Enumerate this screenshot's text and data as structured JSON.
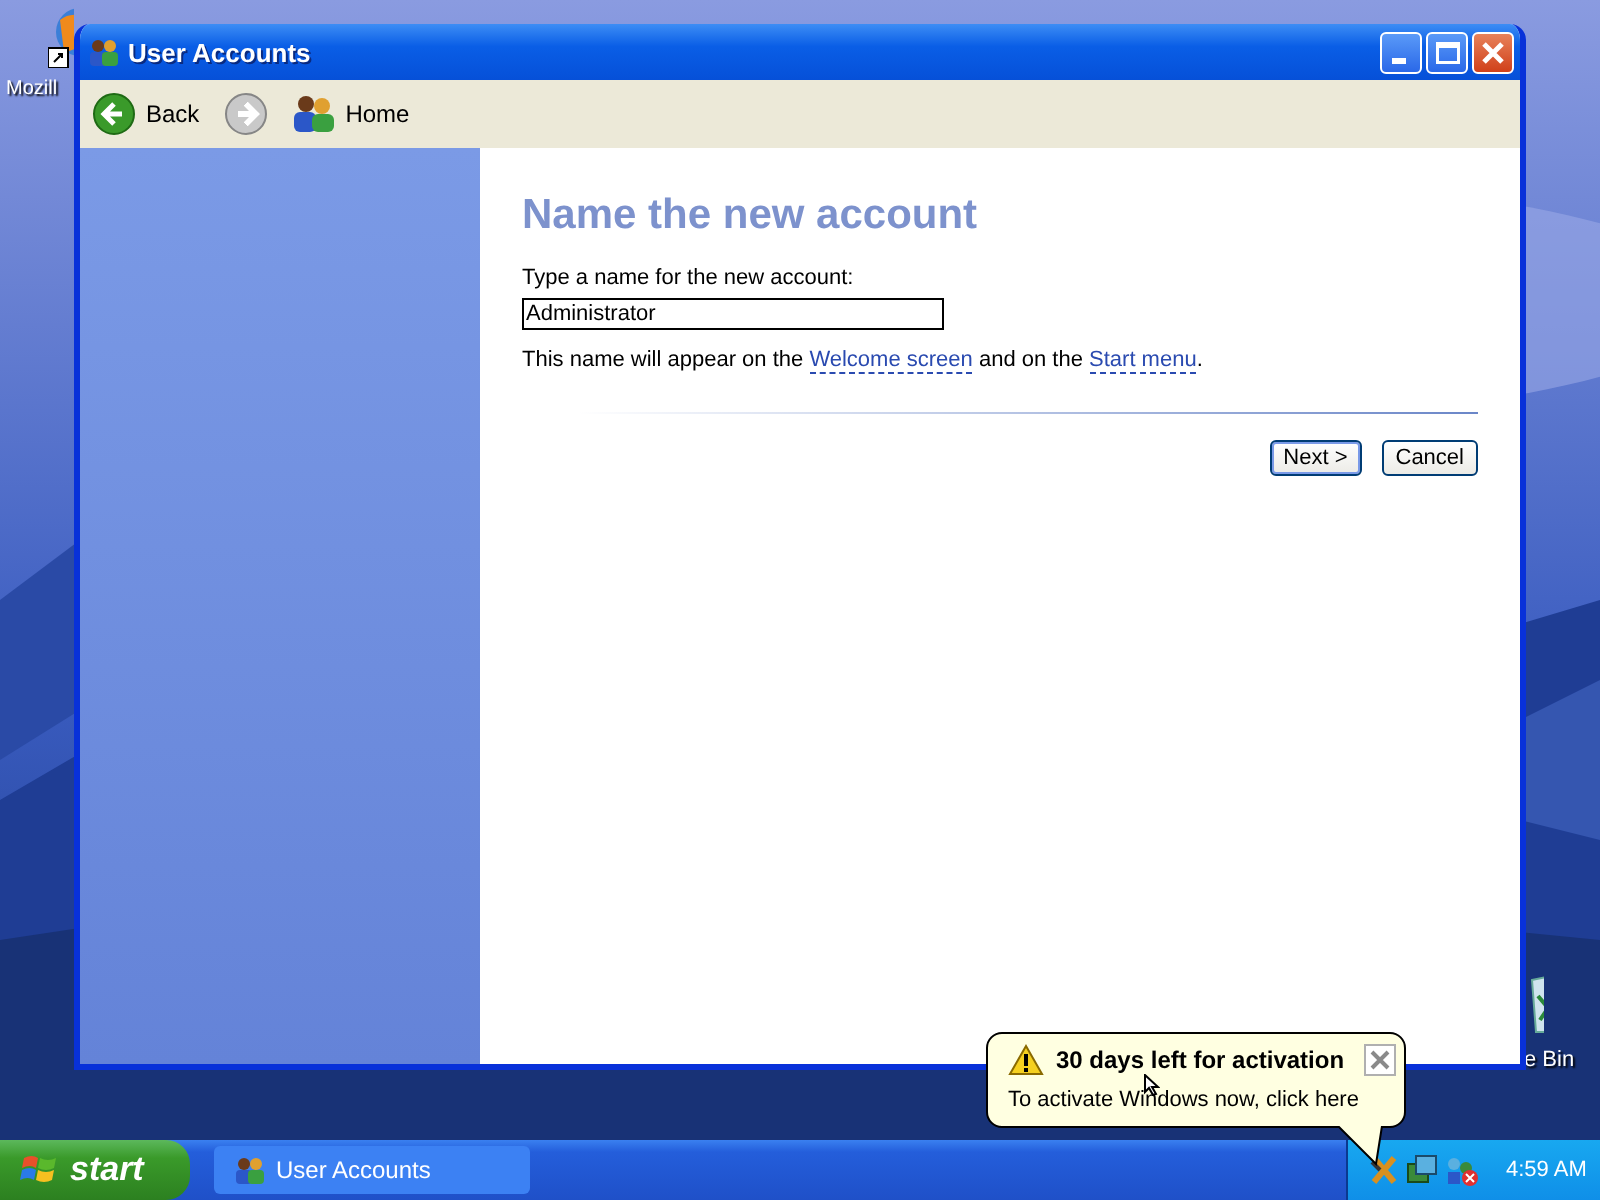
{
  "desktop": {
    "icons": [
      {
        "label": "Mozill",
        "kind": "browser"
      },
      {
        "label": "e Bin",
        "kind": "bin"
      }
    ]
  },
  "window": {
    "title": "User Accounts",
    "toolbar": [
      {
        "kind": "back",
        "label": "Back",
        "disabled": false
      },
      {
        "kind": "forward",
        "disabled": true
      },
      {
        "kind": "home",
        "label": "Home",
        "disabled": false
      }
    ],
    "heading": "Name the new account",
    "prompt": "Type a name for the new account:",
    "field": {
      "value": "Administrator"
    },
    "note": [
      {
        "text": "This name will appear on the ",
        "link": false
      },
      {
        "text": "Welcome screen",
        "link": true
      },
      {
        "text": " and on the ",
        "link": false
      },
      {
        "text": "Start menu",
        "link": true
      },
      {
        "text": ".",
        "link": false
      }
    ],
    "buttons": [
      {
        "label": "Next >",
        "default": true
      },
      {
        "label": "Cancel",
        "default": false
      }
    ]
  },
  "balloon": {
    "title": "30 days left for activation",
    "text": "To activate Windows now, click here"
  },
  "taskbar": {
    "start": "start",
    "tasks": [
      {
        "label": "User Accounts",
        "selected": false
      }
    ],
    "clock": "4:59 AM"
  }
}
